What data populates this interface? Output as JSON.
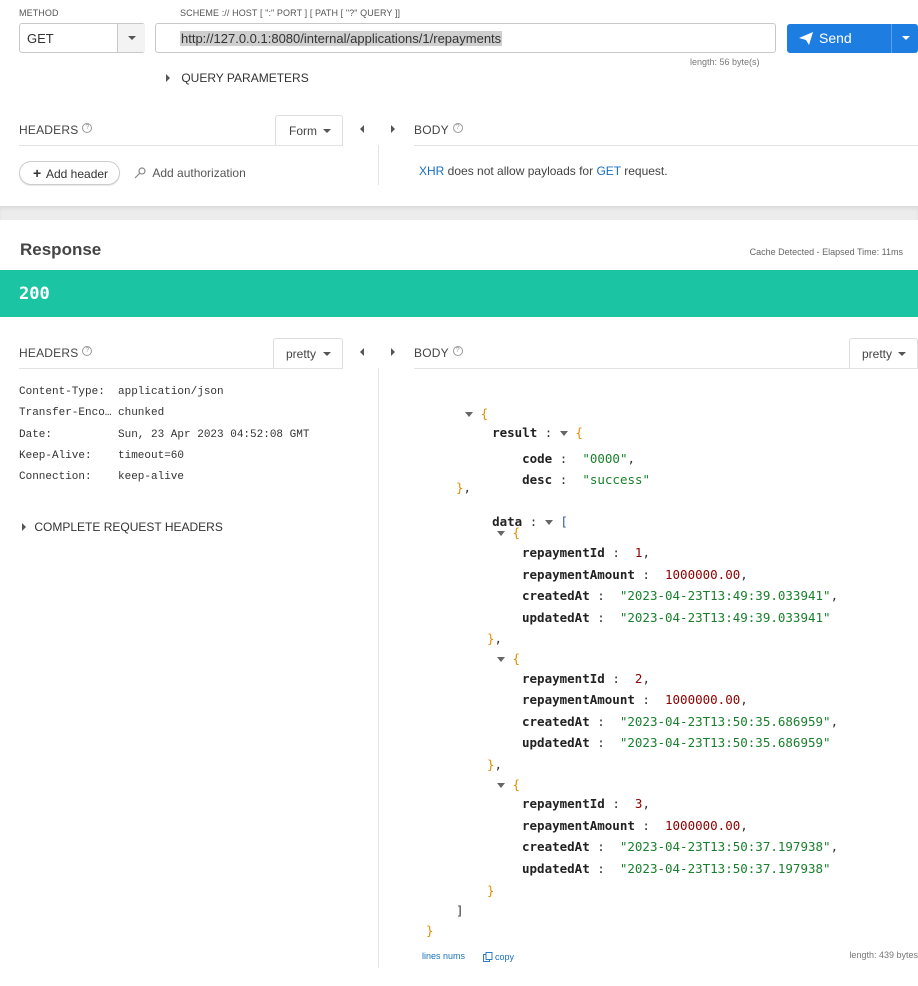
{
  "request": {
    "method_label": "METHOD",
    "method_value": "GET",
    "url_label": "SCHEME :// HOST [ \":\" PORT ] [ PATH [ \"?\" QUERY ]]",
    "url_value": "http://127.0.0.1:8080/internal/applications/1/repayments",
    "url_length": "length: 56 byte(s)",
    "send_label": "Send",
    "query_params_label": "QUERY PARAMETERS",
    "headers_label": "HEADERS",
    "headers_mode": "Form",
    "add_header_label": "Add header",
    "add_auth_label": "Add authorization",
    "body_label": "BODY",
    "body_note_xhr": "XHR",
    "body_note_mid": " does not allow payloads for ",
    "body_note_get": "GET",
    "body_note_end": " request.",
    "help_glyph": "?"
  },
  "response": {
    "title": "Response",
    "cache_info": "Cache Detected - Elapsed Time: 11ms",
    "status_code": "200",
    "status_color": "#1bc4a3",
    "headers_label": "HEADERS",
    "headers_mode": "pretty",
    "body_label": "BODY",
    "body_mode": "pretty",
    "headers": [
      {
        "name": "Content-Type:",
        "value": "application/json"
      },
      {
        "name": "Transfer-Enco…",
        "value": "chunked"
      },
      {
        "name": "Date:",
        "value": "Sun, 23 Apr 2023 04:52:08 GMT"
      },
      {
        "name": "Keep-Alive:",
        "value": "timeout=60"
      },
      {
        "name": "Connection:",
        "value": "keep-alive"
      }
    ],
    "complete_headers_label": "COMPLETE REQUEST HEADERS",
    "json": {
      "result_key": "result",
      "code_key": "code",
      "code_val": "\"0000\"",
      "desc_key": "desc",
      "desc_val": "\"success\"",
      "data_key": "data",
      "items": [
        {
          "repaymentId": "1",
          "repaymentAmount": "1000000.00",
          "createdAt": "\"2023-04-23T13:49:39.033941\"",
          "updatedAt": "\"2023-04-23T13:49:39.033941\""
        },
        {
          "repaymentId": "2",
          "repaymentAmount": "1000000.00",
          "createdAt": "\"2023-04-23T13:50:35.686959\"",
          "updatedAt": "\"2023-04-23T13:50:35.686959\""
        },
        {
          "repaymentId": "3",
          "repaymentAmount": "1000000.00",
          "createdAt": "\"2023-04-23T13:50:37.197938\"",
          "updatedAt": "\"2023-04-23T13:50:37.197938\""
        }
      ],
      "k_repaymentId": "repaymentId",
      "k_repaymentAmount": "repaymentAmount",
      "k_createdAt": "createdAt",
      "k_updatedAt": "updatedAt"
    },
    "lines_nums_label": "lines nums",
    "copy_label": "copy",
    "body_length": "length: 439 bytes"
  },
  "colors": {
    "send_button": "#1e7de0",
    "link": "#1a6fc0",
    "status_bar": "#1bc4a3"
  }
}
